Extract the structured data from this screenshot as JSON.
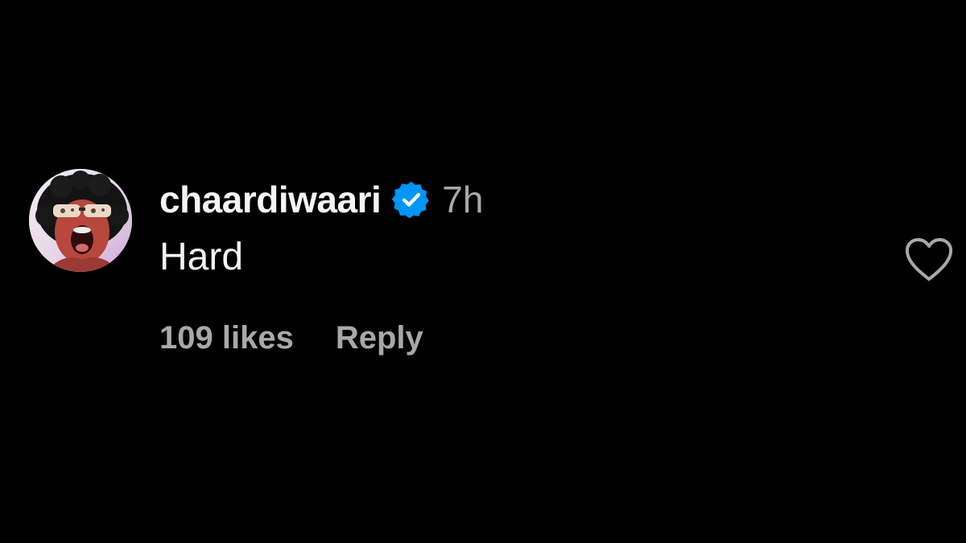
{
  "comment": {
    "username": "chaardiwaari",
    "verified": true,
    "timestamp": "7h",
    "text": "Hard",
    "likes_label": "109 likes",
    "reply_label": "Reply",
    "liked": false
  },
  "colors": {
    "background": "#000000",
    "primary_text": "#f5f5f5",
    "secondary_text": "#a8a8a8",
    "verified_badge": "#0095f6"
  },
  "icons": {
    "avatar": "profile-photo",
    "verified": "verified-badge-icon",
    "like": "heart-outline-icon"
  }
}
